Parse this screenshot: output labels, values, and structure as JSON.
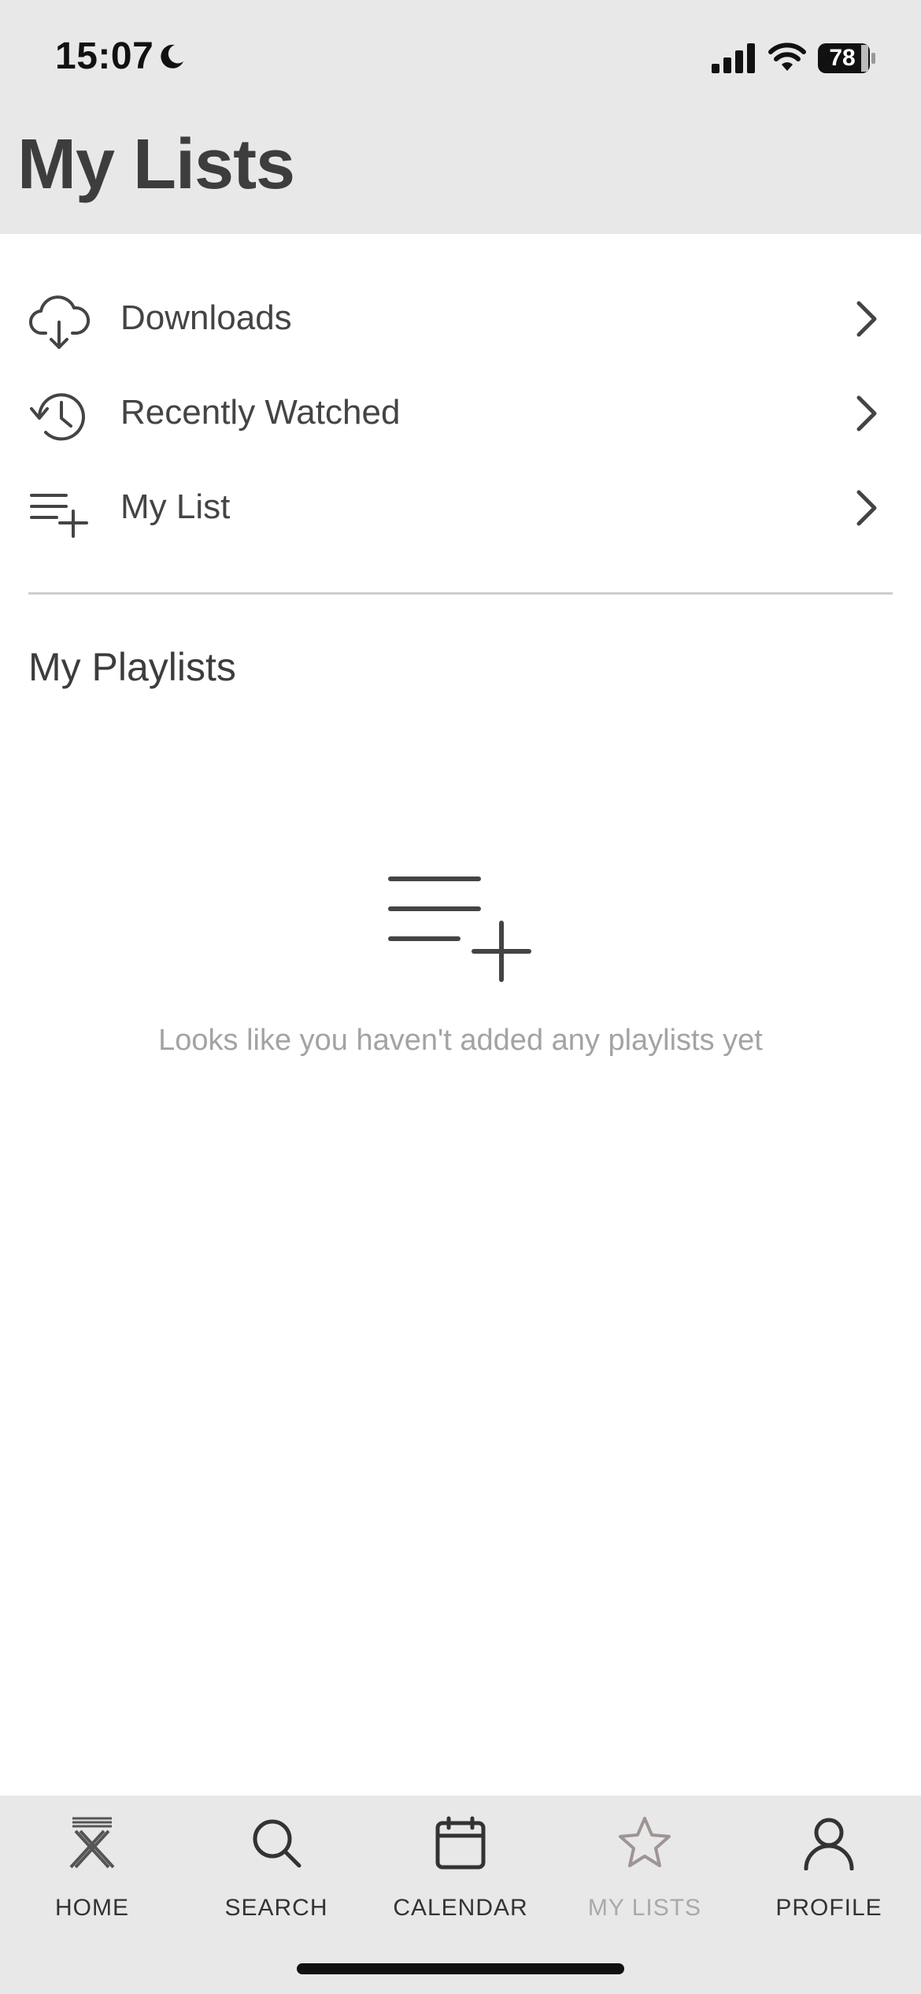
{
  "status_bar": {
    "time": "15:07",
    "battery": "78"
  },
  "page": {
    "title": "My Lists"
  },
  "menu": {
    "items": [
      {
        "label": "Downloads",
        "icon": "cloud-download-icon"
      },
      {
        "label": "Recently Watched",
        "icon": "history-icon"
      },
      {
        "label": "My List",
        "icon": "playlist-add-icon"
      }
    ]
  },
  "playlists": {
    "title": "My Playlists",
    "empty_message": "Looks like you haven't added any playlists yet",
    "empty_icon": "playlist-add-icon"
  },
  "tabbar": {
    "tabs": [
      {
        "label": "HOME",
        "icon": "home-logo-icon"
      },
      {
        "label": "SEARCH",
        "icon": "search-icon"
      },
      {
        "label": "CALENDAR",
        "icon": "calendar-icon"
      },
      {
        "label": "MY LISTS",
        "icon": "star-icon",
        "active": true
      },
      {
        "label": "PROFILE",
        "icon": "profile-icon"
      }
    ]
  },
  "colors": {
    "header_bg": "#e8e8e8",
    "text_primary": "#3d3d3d",
    "text_muted": "#a3a3a3",
    "active_tab": "#a9a9a9"
  }
}
